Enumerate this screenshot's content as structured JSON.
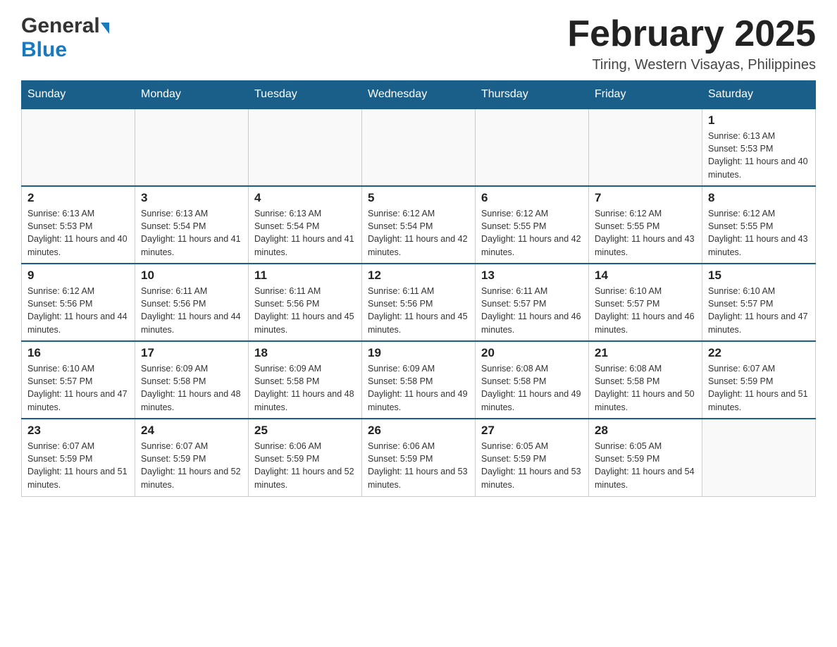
{
  "header": {
    "logo_general": "General",
    "logo_blue": "Blue",
    "title": "February 2025",
    "subtitle": "Tiring, Western Visayas, Philippines"
  },
  "days_of_week": [
    "Sunday",
    "Monday",
    "Tuesday",
    "Wednesday",
    "Thursday",
    "Friday",
    "Saturday"
  ],
  "weeks": [
    {
      "days": [
        {
          "number": "",
          "sunrise": "",
          "sunset": "",
          "daylight": "",
          "empty": true
        },
        {
          "number": "",
          "sunrise": "",
          "sunset": "",
          "daylight": "",
          "empty": true
        },
        {
          "number": "",
          "sunrise": "",
          "sunset": "",
          "daylight": "",
          "empty": true
        },
        {
          "number": "",
          "sunrise": "",
          "sunset": "",
          "daylight": "",
          "empty": true
        },
        {
          "number": "",
          "sunrise": "",
          "sunset": "",
          "daylight": "",
          "empty": true
        },
        {
          "number": "",
          "sunrise": "",
          "sunset": "",
          "daylight": "",
          "empty": true
        },
        {
          "number": "1",
          "sunrise": "Sunrise: 6:13 AM",
          "sunset": "Sunset: 5:53 PM",
          "daylight": "Daylight: 11 hours and 40 minutes.",
          "empty": false
        }
      ]
    },
    {
      "days": [
        {
          "number": "2",
          "sunrise": "Sunrise: 6:13 AM",
          "sunset": "Sunset: 5:53 PM",
          "daylight": "Daylight: 11 hours and 40 minutes.",
          "empty": false
        },
        {
          "number": "3",
          "sunrise": "Sunrise: 6:13 AM",
          "sunset": "Sunset: 5:54 PM",
          "daylight": "Daylight: 11 hours and 41 minutes.",
          "empty": false
        },
        {
          "number": "4",
          "sunrise": "Sunrise: 6:13 AM",
          "sunset": "Sunset: 5:54 PM",
          "daylight": "Daylight: 11 hours and 41 minutes.",
          "empty": false
        },
        {
          "number": "5",
          "sunrise": "Sunrise: 6:12 AM",
          "sunset": "Sunset: 5:54 PM",
          "daylight": "Daylight: 11 hours and 42 minutes.",
          "empty": false
        },
        {
          "number": "6",
          "sunrise": "Sunrise: 6:12 AM",
          "sunset": "Sunset: 5:55 PM",
          "daylight": "Daylight: 11 hours and 42 minutes.",
          "empty": false
        },
        {
          "number": "7",
          "sunrise": "Sunrise: 6:12 AM",
          "sunset": "Sunset: 5:55 PM",
          "daylight": "Daylight: 11 hours and 43 minutes.",
          "empty": false
        },
        {
          "number": "8",
          "sunrise": "Sunrise: 6:12 AM",
          "sunset": "Sunset: 5:55 PM",
          "daylight": "Daylight: 11 hours and 43 minutes.",
          "empty": false
        }
      ]
    },
    {
      "days": [
        {
          "number": "9",
          "sunrise": "Sunrise: 6:12 AM",
          "sunset": "Sunset: 5:56 PM",
          "daylight": "Daylight: 11 hours and 44 minutes.",
          "empty": false
        },
        {
          "number": "10",
          "sunrise": "Sunrise: 6:11 AM",
          "sunset": "Sunset: 5:56 PM",
          "daylight": "Daylight: 11 hours and 44 minutes.",
          "empty": false
        },
        {
          "number": "11",
          "sunrise": "Sunrise: 6:11 AM",
          "sunset": "Sunset: 5:56 PM",
          "daylight": "Daylight: 11 hours and 45 minutes.",
          "empty": false
        },
        {
          "number": "12",
          "sunrise": "Sunrise: 6:11 AM",
          "sunset": "Sunset: 5:56 PM",
          "daylight": "Daylight: 11 hours and 45 minutes.",
          "empty": false
        },
        {
          "number": "13",
          "sunrise": "Sunrise: 6:11 AM",
          "sunset": "Sunset: 5:57 PM",
          "daylight": "Daylight: 11 hours and 46 minutes.",
          "empty": false
        },
        {
          "number": "14",
          "sunrise": "Sunrise: 6:10 AM",
          "sunset": "Sunset: 5:57 PM",
          "daylight": "Daylight: 11 hours and 46 minutes.",
          "empty": false
        },
        {
          "number": "15",
          "sunrise": "Sunrise: 6:10 AM",
          "sunset": "Sunset: 5:57 PM",
          "daylight": "Daylight: 11 hours and 47 minutes.",
          "empty": false
        }
      ]
    },
    {
      "days": [
        {
          "number": "16",
          "sunrise": "Sunrise: 6:10 AM",
          "sunset": "Sunset: 5:57 PM",
          "daylight": "Daylight: 11 hours and 47 minutes.",
          "empty": false
        },
        {
          "number": "17",
          "sunrise": "Sunrise: 6:09 AM",
          "sunset": "Sunset: 5:58 PM",
          "daylight": "Daylight: 11 hours and 48 minutes.",
          "empty": false
        },
        {
          "number": "18",
          "sunrise": "Sunrise: 6:09 AM",
          "sunset": "Sunset: 5:58 PM",
          "daylight": "Daylight: 11 hours and 48 minutes.",
          "empty": false
        },
        {
          "number": "19",
          "sunrise": "Sunrise: 6:09 AM",
          "sunset": "Sunset: 5:58 PM",
          "daylight": "Daylight: 11 hours and 49 minutes.",
          "empty": false
        },
        {
          "number": "20",
          "sunrise": "Sunrise: 6:08 AM",
          "sunset": "Sunset: 5:58 PM",
          "daylight": "Daylight: 11 hours and 49 minutes.",
          "empty": false
        },
        {
          "number": "21",
          "sunrise": "Sunrise: 6:08 AM",
          "sunset": "Sunset: 5:58 PM",
          "daylight": "Daylight: 11 hours and 50 minutes.",
          "empty": false
        },
        {
          "number": "22",
          "sunrise": "Sunrise: 6:07 AM",
          "sunset": "Sunset: 5:59 PM",
          "daylight": "Daylight: 11 hours and 51 minutes.",
          "empty": false
        }
      ]
    },
    {
      "days": [
        {
          "number": "23",
          "sunrise": "Sunrise: 6:07 AM",
          "sunset": "Sunset: 5:59 PM",
          "daylight": "Daylight: 11 hours and 51 minutes.",
          "empty": false
        },
        {
          "number": "24",
          "sunrise": "Sunrise: 6:07 AM",
          "sunset": "Sunset: 5:59 PM",
          "daylight": "Daylight: 11 hours and 52 minutes.",
          "empty": false
        },
        {
          "number": "25",
          "sunrise": "Sunrise: 6:06 AM",
          "sunset": "Sunset: 5:59 PM",
          "daylight": "Daylight: 11 hours and 52 minutes.",
          "empty": false
        },
        {
          "number": "26",
          "sunrise": "Sunrise: 6:06 AM",
          "sunset": "Sunset: 5:59 PM",
          "daylight": "Daylight: 11 hours and 53 minutes.",
          "empty": false
        },
        {
          "number": "27",
          "sunrise": "Sunrise: 6:05 AM",
          "sunset": "Sunset: 5:59 PM",
          "daylight": "Daylight: 11 hours and 53 minutes.",
          "empty": false
        },
        {
          "number": "28",
          "sunrise": "Sunrise: 6:05 AM",
          "sunset": "Sunset: 5:59 PM",
          "daylight": "Daylight: 11 hours and 54 minutes.",
          "empty": false
        },
        {
          "number": "",
          "sunrise": "",
          "sunset": "",
          "daylight": "",
          "empty": true
        }
      ]
    }
  ]
}
